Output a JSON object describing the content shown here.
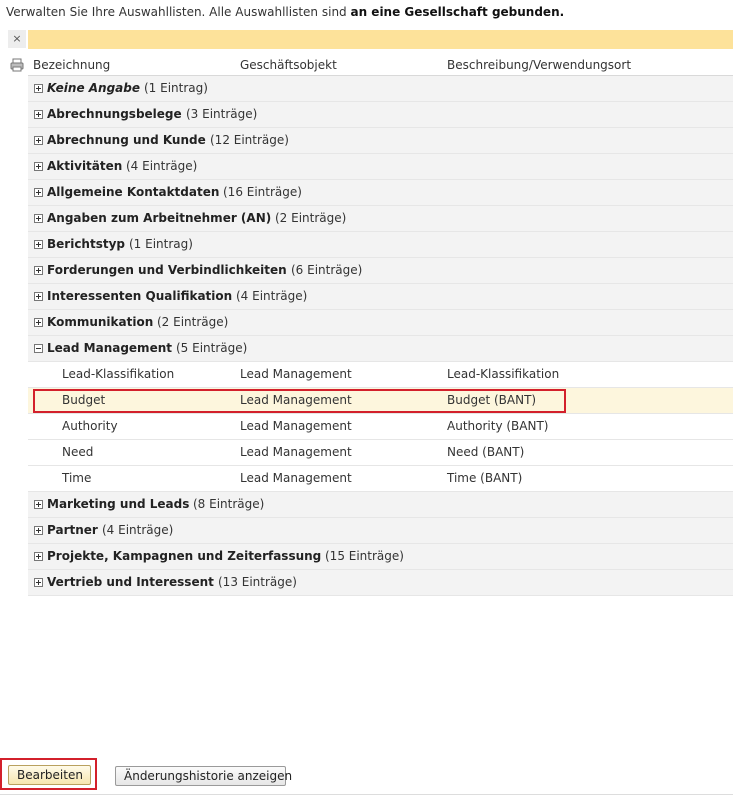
{
  "intro": {
    "text_normal": "Verwalten Sie Ihre Auswahllisten. Alle Auswahllisten sind ",
    "text_bold": "an eine Gesellschaft gebunden."
  },
  "toolbar": {
    "close_icon": "×",
    "print_icon": "printer-icon"
  },
  "table": {
    "headers": {
      "bezeichnung": "Bezeichnung",
      "geschaeftsobjekt": "Geschäftsobjekt",
      "beschreibung": "Beschreibung/Verwendungsort"
    },
    "groups_before": [
      {
        "name": "Keine Angabe",
        "count": "(1 Eintrag)",
        "italic": true
      },
      {
        "name": "Abrechnungsbelege",
        "count": "(3 Einträge)"
      },
      {
        "name": "Abrechnung und Kunde",
        "count": "(12 Einträge)"
      },
      {
        "name": "Aktivitäten",
        "count": "(4 Einträge)"
      },
      {
        "name": "Allgemeine Kontaktdaten",
        "count": "(16 Einträge)"
      },
      {
        "name": "Angaben zum Arbeitnehmer (AN)",
        "count": "(2 Einträge)"
      },
      {
        "name": "Berichtstyp",
        "count": "(1 Eintrag)"
      },
      {
        "name": "Forderungen und Verbindlichkeiten",
        "count": "(6 Einträge)"
      },
      {
        "name": "Interessenten Qualifikation",
        "count": "(4 Einträge)"
      },
      {
        "name": "Kommunikation",
        "count": "(2 Einträge)"
      }
    ],
    "expanded_group": {
      "name": "Lead Management",
      "count": "(5 Einträge)",
      "items": [
        {
          "bezeichnung": "Lead-Klassifikation",
          "objekt": "Lead Management",
          "beschreibung": "Lead-Klassifikation"
        },
        {
          "bezeichnung": "Budget",
          "objekt": "Lead Management",
          "beschreibung": "Budget (BANT)"
        },
        {
          "bezeichnung": "Authority",
          "objekt": "Lead Management",
          "beschreibung": "Authority (BANT)"
        },
        {
          "bezeichnung": "Need",
          "objekt": "Lead Management",
          "beschreibung": "Need (BANT)"
        },
        {
          "bezeichnung": "Time",
          "objekt": "Lead Management",
          "beschreibung": "Time (BANT)"
        }
      ]
    },
    "groups_after": [
      {
        "name": "Marketing und Leads",
        "count": "(8 Einträge)"
      },
      {
        "name": "Partner",
        "count": "(4 Einträge)"
      },
      {
        "name": "Projekte, Kampagnen und Zeiterfassung",
        "count": "(15 Einträge)"
      },
      {
        "name": "Vertrieb und Interessent",
        "count": "(13 Einträge)"
      }
    ]
  },
  "buttons": {
    "edit_label": "Bearbeiten",
    "history_label": "Änderungshistorie anzeigen"
  },
  "colors": {
    "yellow_bar": "#fde29a",
    "highlight": "#d3202b",
    "selected_row": "#fdf6dd"
  }
}
